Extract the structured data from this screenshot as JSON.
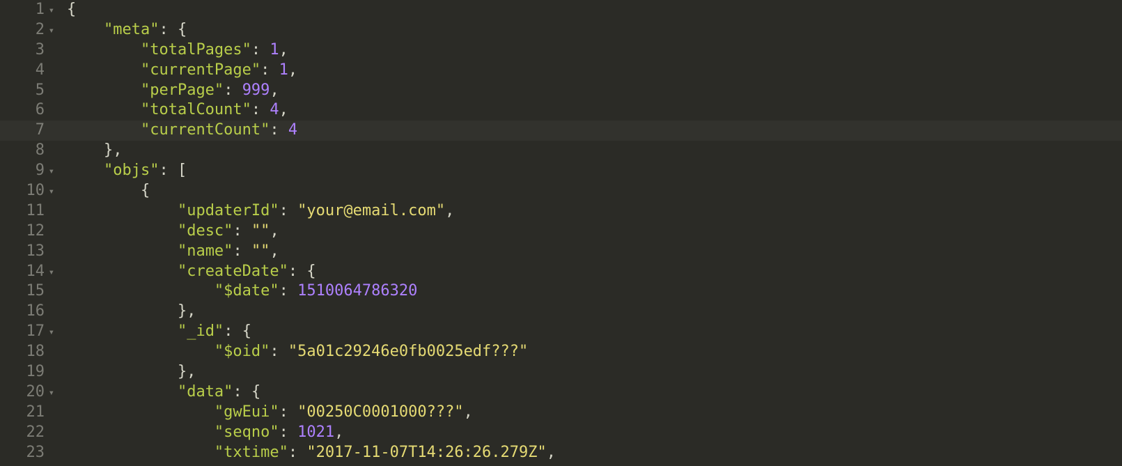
{
  "lines": [
    {
      "num": "1",
      "fold": true,
      "tokens": [
        {
          "cls": "tok-punc",
          "t": "{"
        }
      ]
    },
    {
      "num": "2",
      "fold": true,
      "tokens": [
        {
          "cls": "tok-punc",
          "t": "    "
        },
        {
          "cls": "tok-key",
          "t": "\"meta\""
        },
        {
          "cls": "tok-colon",
          "t": ": "
        },
        {
          "cls": "tok-punc",
          "t": "{"
        }
      ]
    },
    {
      "num": "3",
      "fold": false,
      "tokens": [
        {
          "cls": "tok-punc",
          "t": "        "
        },
        {
          "cls": "tok-key",
          "t": "\"totalPages\""
        },
        {
          "cls": "tok-colon",
          "t": ": "
        },
        {
          "cls": "tok-num",
          "t": "1"
        },
        {
          "cls": "tok-punc",
          "t": ","
        }
      ]
    },
    {
      "num": "4",
      "fold": false,
      "tokens": [
        {
          "cls": "tok-punc",
          "t": "        "
        },
        {
          "cls": "tok-key",
          "t": "\"currentPage\""
        },
        {
          "cls": "tok-colon",
          "t": ": "
        },
        {
          "cls": "tok-num",
          "t": "1"
        },
        {
          "cls": "tok-punc",
          "t": ","
        }
      ]
    },
    {
      "num": "5",
      "fold": false,
      "tokens": [
        {
          "cls": "tok-punc",
          "t": "        "
        },
        {
          "cls": "tok-key",
          "t": "\"perPage\""
        },
        {
          "cls": "tok-colon",
          "t": ": "
        },
        {
          "cls": "tok-num",
          "t": "999"
        },
        {
          "cls": "tok-punc",
          "t": ","
        }
      ]
    },
    {
      "num": "6",
      "fold": false,
      "tokens": [
        {
          "cls": "tok-punc",
          "t": "        "
        },
        {
          "cls": "tok-key",
          "t": "\"totalCount\""
        },
        {
          "cls": "tok-colon",
          "t": ": "
        },
        {
          "cls": "tok-num",
          "t": "4"
        },
        {
          "cls": "tok-punc",
          "t": ","
        }
      ]
    },
    {
      "num": "7",
      "fold": false,
      "highlight": true,
      "tokens": [
        {
          "cls": "tok-punc",
          "t": "        "
        },
        {
          "cls": "tok-key",
          "t": "\"currentCount\""
        },
        {
          "cls": "tok-colon",
          "t": ": "
        },
        {
          "cls": "tok-num",
          "t": "4"
        }
      ]
    },
    {
      "num": "8",
      "fold": false,
      "tokens": [
        {
          "cls": "tok-punc",
          "t": "    },"
        }
      ]
    },
    {
      "num": "9",
      "fold": true,
      "tokens": [
        {
          "cls": "tok-punc",
          "t": "    "
        },
        {
          "cls": "tok-key",
          "t": "\"objs\""
        },
        {
          "cls": "tok-colon",
          "t": ": "
        },
        {
          "cls": "tok-punc",
          "t": "["
        }
      ]
    },
    {
      "num": "10",
      "fold": true,
      "tokens": [
        {
          "cls": "tok-punc",
          "t": "        {"
        }
      ]
    },
    {
      "num": "11",
      "fold": false,
      "tokens": [
        {
          "cls": "tok-punc",
          "t": "            "
        },
        {
          "cls": "tok-key",
          "t": "\"updaterId\""
        },
        {
          "cls": "tok-colon",
          "t": ": "
        },
        {
          "cls": "tok-string",
          "t": "\"your@email.com\""
        },
        {
          "cls": "tok-punc",
          "t": ","
        }
      ]
    },
    {
      "num": "12",
      "fold": false,
      "tokens": [
        {
          "cls": "tok-punc",
          "t": "            "
        },
        {
          "cls": "tok-key",
          "t": "\"desc\""
        },
        {
          "cls": "tok-colon",
          "t": ": "
        },
        {
          "cls": "tok-string",
          "t": "\"\""
        },
        {
          "cls": "tok-punc",
          "t": ","
        }
      ]
    },
    {
      "num": "13",
      "fold": false,
      "tokens": [
        {
          "cls": "tok-punc",
          "t": "            "
        },
        {
          "cls": "tok-key",
          "t": "\"name\""
        },
        {
          "cls": "tok-colon",
          "t": ": "
        },
        {
          "cls": "tok-string",
          "t": "\"\""
        },
        {
          "cls": "tok-punc",
          "t": ","
        }
      ]
    },
    {
      "num": "14",
      "fold": true,
      "tokens": [
        {
          "cls": "tok-punc",
          "t": "            "
        },
        {
          "cls": "tok-key",
          "t": "\"createDate\""
        },
        {
          "cls": "tok-colon",
          "t": ": "
        },
        {
          "cls": "tok-punc",
          "t": "{"
        }
      ]
    },
    {
      "num": "15",
      "fold": false,
      "tokens": [
        {
          "cls": "tok-punc",
          "t": "                "
        },
        {
          "cls": "tok-key",
          "t": "\"$date\""
        },
        {
          "cls": "tok-colon",
          "t": ": "
        },
        {
          "cls": "tok-num",
          "t": "1510064786320"
        }
      ]
    },
    {
      "num": "16",
      "fold": false,
      "tokens": [
        {
          "cls": "tok-punc",
          "t": "            },"
        }
      ]
    },
    {
      "num": "17",
      "fold": true,
      "tokens": [
        {
          "cls": "tok-punc",
          "t": "            "
        },
        {
          "cls": "tok-key",
          "t": "\"_id\""
        },
        {
          "cls": "tok-colon",
          "t": ": "
        },
        {
          "cls": "tok-punc",
          "t": "{"
        }
      ]
    },
    {
      "num": "18",
      "fold": false,
      "tokens": [
        {
          "cls": "tok-punc",
          "t": "                "
        },
        {
          "cls": "tok-key",
          "t": "\"$oid\""
        },
        {
          "cls": "tok-colon",
          "t": ": "
        },
        {
          "cls": "tok-string",
          "t": "\"5a01c29246e0fb0025edf???\""
        }
      ]
    },
    {
      "num": "19",
      "fold": false,
      "tokens": [
        {
          "cls": "tok-punc",
          "t": "            },"
        }
      ]
    },
    {
      "num": "20",
      "fold": true,
      "tokens": [
        {
          "cls": "tok-punc",
          "t": "            "
        },
        {
          "cls": "tok-key",
          "t": "\"data\""
        },
        {
          "cls": "tok-colon",
          "t": ": "
        },
        {
          "cls": "tok-punc",
          "t": "{"
        }
      ]
    },
    {
      "num": "21",
      "fold": false,
      "tokens": [
        {
          "cls": "tok-punc",
          "t": "                "
        },
        {
          "cls": "tok-key",
          "t": "\"gwEui\""
        },
        {
          "cls": "tok-colon",
          "t": ": "
        },
        {
          "cls": "tok-string",
          "t": "\"00250C0001000???\""
        },
        {
          "cls": "tok-punc",
          "t": ","
        }
      ]
    },
    {
      "num": "22",
      "fold": false,
      "tokens": [
        {
          "cls": "tok-punc",
          "t": "                "
        },
        {
          "cls": "tok-key",
          "t": "\"seqno\""
        },
        {
          "cls": "tok-colon",
          "t": ": "
        },
        {
          "cls": "tok-num",
          "t": "1021"
        },
        {
          "cls": "tok-punc",
          "t": ","
        }
      ]
    },
    {
      "num": "23",
      "fold": false,
      "tokens": [
        {
          "cls": "tok-punc",
          "t": "                "
        },
        {
          "cls": "tok-key",
          "t": "\"txtime\""
        },
        {
          "cls": "tok-colon",
          "t": ": "
        },
        {
          "cls": "tok-string",
          "t": "\"2017-11-07T14:26:26.279Z\""
        },
        {
          "cls": "tok-punc",
          "t": ","
        }
      ]
    }
  ],
  "foldGlyph": "▾"
}
